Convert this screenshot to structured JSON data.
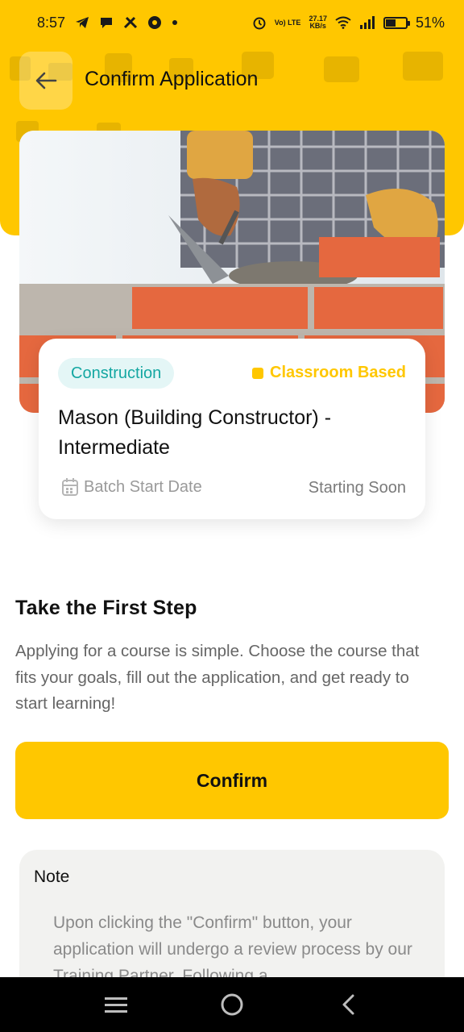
{
  "status_bar": {
    "time": "8:57",
    "net_speed_value": "27.17",
    "net_speed_unit": "KB/s",
    "network_type": "Vo) LTE",
    "battery_percent": "51%",
    "battery_level": 0.51
  },
  "app_bar": {
    "title": "Confirm Application"
  },
  "course": {
    "category": "Construction",
    "mode": "Classroom Based",
    "title": "Mason (Building Constructor) - Intermediate",
    "batch_label": "Batch Start Date",
    "batch_value": "Starting Soon"
  },
  "intro": {
    "heading": "Take the First Step",
    "description": "Applying for a course is simple. Choose the course that fits your goals, fill out the application, and get ready to start learning!"
  },
  "actions": {
    "confirm_label": "Confirm"
  },
  "note": {
    "title": "Note",
    "text": "Upon clicking the \"Confirm\" button, your application will undergo a review process by our Training Partner. Following a"
  },
  "colors": {
    "accent": "#FFC700",
    "badge_bg": "#E4F6F6",
    "badge_text": "#14A7A2",
    "note_bg": "#F2F2F0"
  },
  "icons": {
    "back": "arrow-left-icon",
    "calendar": "calendar-icon",
    "nav_recent": "menu-icon",
    "nav_home": "circle-icon",
    "nav_back": "chevron-left-icon"
  }
}
